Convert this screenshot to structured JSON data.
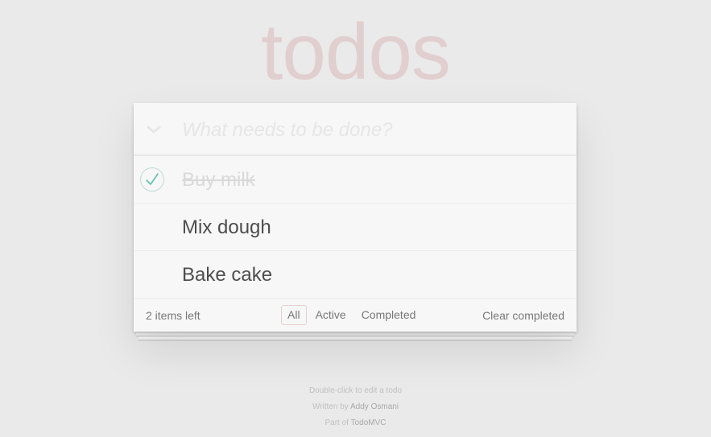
{
  "app": {
    "title": "todos"
  },
  "header": {
    "new_todo_placeholder": "What needs to be done?",
    "toggle_all_icon": "chevron-down-icon"
  },
  "todos": [
    {
      "label": "Buy milk",
      "completed": true
    },
    {
      "label": "Mix dough",
      "completed": false
    },
    {
      "label": "Bake cake",
      "completed": false
    }
  ],
  "footer": {
    "count_text": "2 items left",
    "filters": [
      {
        "label": "All",
        "selected": true
      },
      {
        "label": "Active",
        "selected": false
      },
      {
        "label": "Completed",
        "selected": false
      }
    ],
    "clear_completed": "Clear completed"
  },
  "info": {
    "edit_hint": "Double-click to edit a todo",
    "written_by_prefix": "Written by",
    "author": "Addy Osmani",
    "part_of_prefix": "Part of",
    "project": "TodoMVC"
  },
  "colors": {
    "title": "#f0dede",
    "check_accent": "#5dc2af",
    "filter_selected_border": "#efd5d5",
    "background": "#eaeaea"
  }
}
